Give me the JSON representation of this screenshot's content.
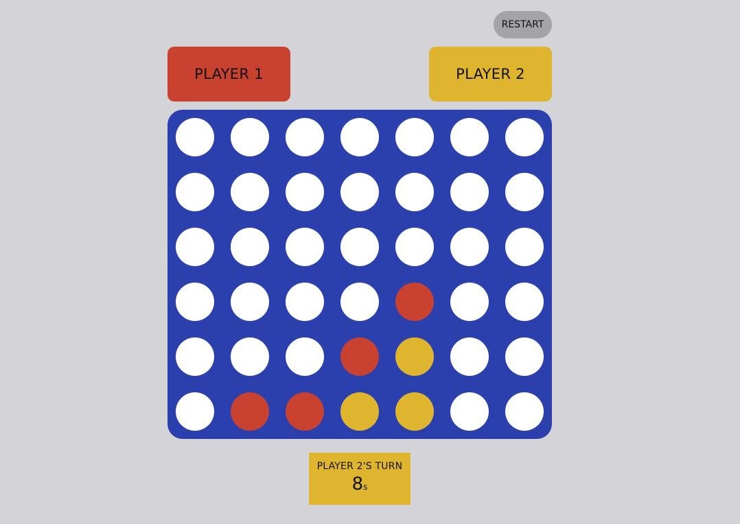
{
  "header": {
    "restart_label": "RESTART"
  },
  "players": [
    {
      "label": "PLAYER 1",
      "color": "#c9412f"
    },
    {
      "label": "PLAYER 2",
      "color": "#dfb42e"
    }
  ],
  "board": {
    "color": "#2c40ad",
    "rows": [
      [
        "empty",
        "empty",
        "empty",
        "empty",
        "empty",
        "empty",
        "empty"
      ],
      [
        "empty",
        "empty",
        "empty",
        "empty",
        "empty",
        "empty",
        "empty"
      ],
      [
        "empty",
        "empty",
        "empty",
        "empty",
        "empty",
        "empty",
        "empty"
      ],
      [
        "empty",
        "empty",
        "empty",
        "empty",
        "red",
        "empty",
        "empty"
      ],
      [
        "empty",
        "empty",
        "empty",
        "red",
        "yellow",
        "empty",
        "empty"
      ],
      [
        "empty",
        "red",
        "red",
        "yellow",
        "yellow",
        "empty",
        "empty"
      ]
    ]
  },
  "turn": {
    "label": "PLAYER 2'S TURN",
    "timer_value": "8",
    "timer_unit": "s"
  }
}
